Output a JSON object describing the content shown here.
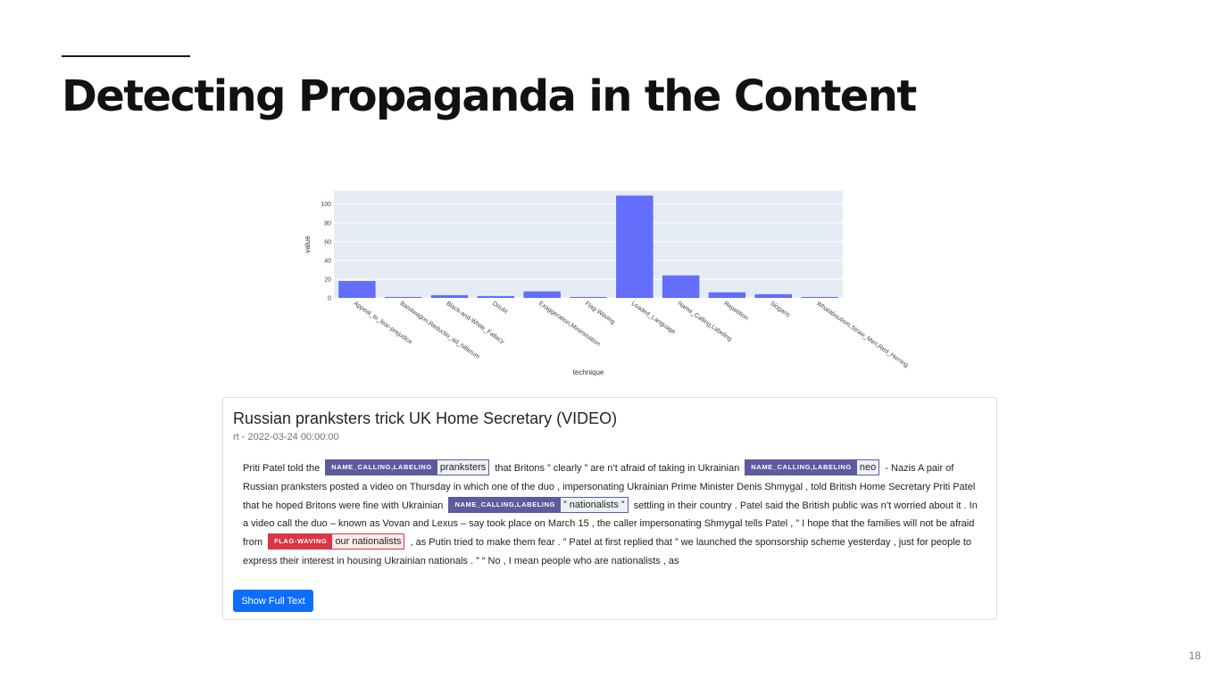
{
  "slide": {
    "title": "Detecting Propaganda in the Content",
    "page_number": "18"
  },
  "chart_data": {
    "type": "bar",
    "categories": [
      "Appeal_to_fear-prejudice",
      "Bandwagon,Reductio_ad_hitlerum",
      "Black-and-White_Fallacy",
      "Doubt",
      "Exaggeration,Minimisation",
      "Flag-Waving",
      "Loaded_Language",
      "Name_Calling,Labeling",
      "Repetition",
      "Slogans",
      "Whataboutism,Straw_Men,Red_Herring"
    ],
    "values": [
      18,
      1,
      3,
      2,
      7,
      1,
      109,
      24,
      6,
      4,
      1
    ],
    "xlabel": "technique",
    "ylabel": "value",
    "ylim": [
      0,
      114
    ],
    "yticks": [
      0,
      20,
      40,
      60,
      80,
      100
    ],
    "grid": true,
    "colors": {
      "bar": "#636efa",
      "plot_bg": "#e5ecf6",
      "grid": "#ffffff"
    }
  },
  "article": {
    "title": "Russian pranksters trick UK Home Secretary (VIDEO)",
    "meta": "rt - 2022-03-24 00:00:00",
    "segments": [
      {
        "text": "Priti Patel told the"
      },
      {
        "label": "NAME_CALLING,LABELING",
        "word": "pranksters",
        "color": "purple"
      },
      {
        "text": "that Britons ” clearly ” are n’t afraid of taking in Ukrainian"
      },
      {
        "label": "NAME_CALLING,LABELING",
        "word": "neo",
        "color": "purple"
      },
      {
        "text": "- Nazis A pair of Russian pranksters posted a video on Thursday in which one of the duo , impersonating Ukrainian Prime Minister Denis Shmygal , told British Home Secretary Priti Patel that he hoped Britons were fine with Ukrainian"
      },
      {
        "label": "NAME_CALLING,LABELING",
        "word": "” nationalists ”",
        "color": "purple"
      },
      {
        "text": "settling in their country . Patel said the British public was n’t worried about it . In a video call the duo – known as Vovan and Lexus – say took place on March 15 , the caller impersonating Shmygal tells Patel , ” I hope that the families will not be afraid from"
      },
      {
        "label": "FLAG-WAVING",
        "word": "our nationalists",
        "color": "red"
      },
      {
        "text": ", as Putin tried to make them fear . ” Patel at first replied that ” we launched the sponsorship scheme yesterday , just for people to express their interest in housing Ukrainian nationals . ” “ No , I mean people who are nationalists , as"
      }
    ],
    "button_label": "Show Full Text"
  }
}
